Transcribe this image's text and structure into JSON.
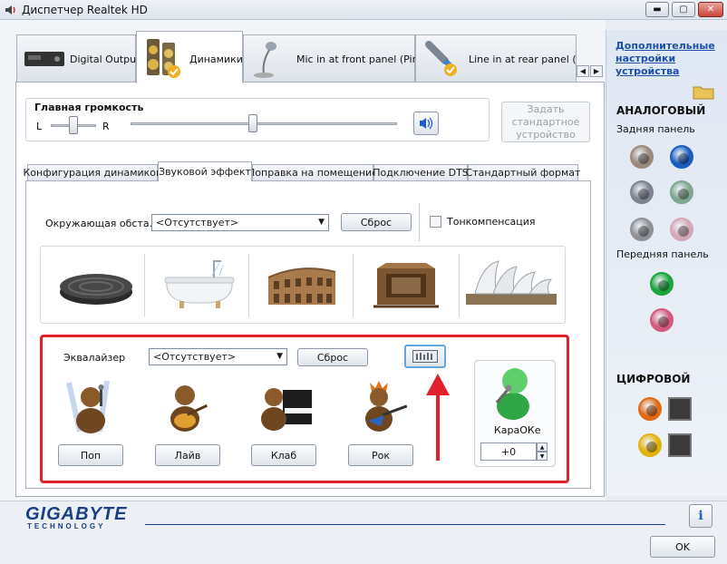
{
  "window": {
    "title": "Диспетчер Realtek HD"
  },
  "device_tabs": [
    {
      "label": "Digital Output"
    },
    {
      "label": "Динамики"
    },
    {
      "label": "Mic in at front panel (Pink)"
    },
    {
      "label": "Line in at rear panel (Blu"
    }
  ],
  "volume": {
    "title": "Главная громкость",
    "left": "L",
    "right": "R",
    "balance": 0.5,
    "level": 0.46
  },
  "set_default": {
    "label": "Задать стандартное устройство"
  },
  "sub_tabs": [
    {
      "label": "Конфигурация динамиков"
    },
    {
      "label": "Звуковой эффект"
    },
    {
      "label": "Поправка на помещение"
    },
    {
      "label": "Подключение DTS"
    },
    {
      "label": "Стандартный формат"
    }
  ],
  "environment": {
    "label": "Окружающая обста...",
    "selected": "<Отсутствует>",
    "reset": "Сброс",
    "loudness": "Тонкомпенсация",
    "presets": [
      "sewer-lid",
      "bathtub",
      "colosseum",
      "stone-room",
      "opera-house"
    ]
  },
  "equalizer": {
    "label": "Эквалайзер",
    "selected": "<Отсутствует>",
    "reset": "Сброс",
    "presets": [
      "Поп",
      "Лайв",
      "Клаб",
      "Рок"
    ],
    "karaoke": {
      "label": "КараОКе",
      "value": "+0"
    }
  },
  "right_panel": {
    "advanced_link": "Дополнительные настройки устройства",
    "analog": "АНАЛОГОВЫЙ",
    "rear": "Задняя панель",
    "front": "Передняя панель",
    "digital": "ЦИФРОВОЙ",
    "colors": {
      "rear": [
        "#9b8a7c",
        "#1c5dc1",
        "#7d8391",
        "#7fa68e",
        "#8f9197",
        "#d3a7b4"
      ],
      "front": [
        "#1aa63a",
        "#d45a7d"
      ],
      "digital": [
        "#e06a16",
        "#e2b20e"
      ]
    }
  },
  "footer": {
    "brand": "GIGABYTE",
    "brand_sub": "TECHNOLOGY",
    "ok": "OK"
  },
  "accent": "#e0202a"
}
